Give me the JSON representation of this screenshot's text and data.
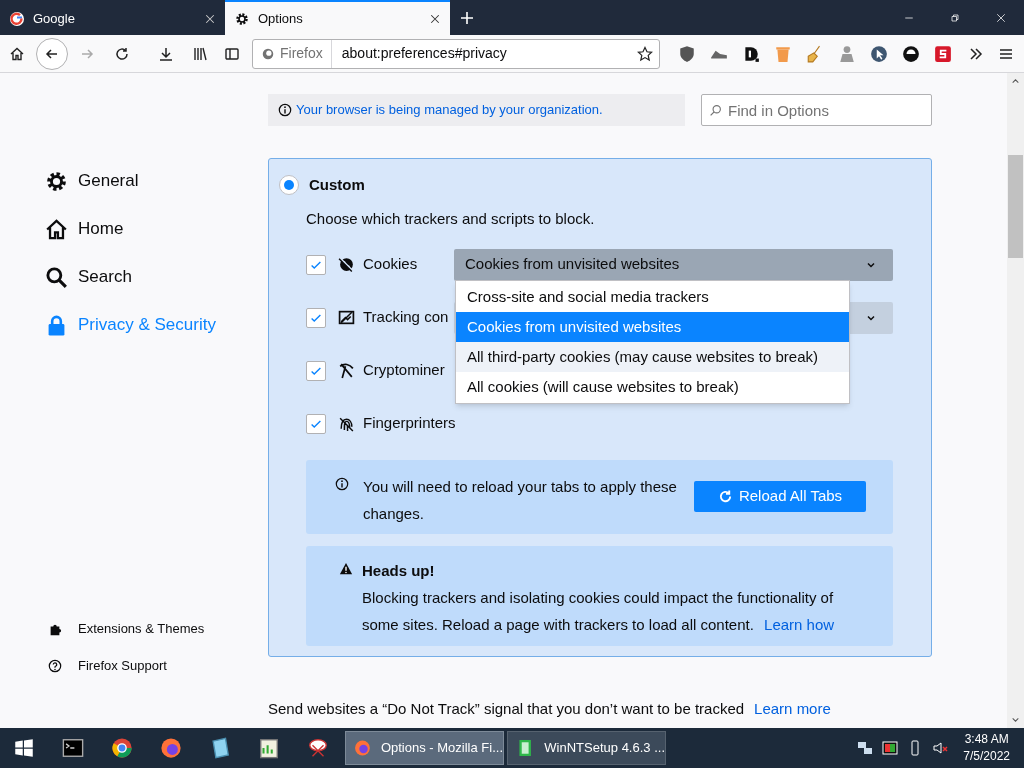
{
  "tabs": [
    {
      "title": "Google",
      "selected": false
    },
    {
      "title": "Options",
      "selected": true
    }
  ],
  "toolbar": {
    "identity": "Firefox",
    "url": "about:preferences#privacy"
  },
  "sidebar": {
    "items": [
      {
        "label": "General",
        "selected": false
      },
      {
        "label": "Home",
        "selected": false
      },
      {
        "label": "Search",
        "selected": false
      },
      {
        "label": "Privacy & Security",
        "selected": true
      }
    ],
    "footer": [
      "Extensions & Themes",
      "Firefox Support"
    ]
  },
  "managed_notice": "Your browser is being managed by your organization.",
  "search": {
    "placeholder": "Find in Options"
  },
  "custom": {
    "title": "Custom",
    "selected": true,
    "description": "Choose which trackers and scripts to block.",
    "trackers": [
      {
        "label": "Cookies",
        "checked": true,
        "dropdown": "Cookies from unvisited websites",
        "expanded": true
      },
      {
        "label": "Tracking con",
        "checked": true,
        "expanded": false
      },
      {
        "label": "Cryptominer",
        "checked": true
      },
      {
        "label": "Fingerprinters",
        "checked": true
      }
    ],
    "options": [
      {
        "label": "Cross-site and social media trackers",
        "selected": false,
        "hovered": false
      },
      {
        "label": "Cookies from unvisited websites",
        "selected": true,
        "hovered": false
      },
      {
        "label": "All third-party cookies (may cause websites to break)",
        "selected": false,
        "hovered": true
      },
      {
        "label": "All cookies (will cause websites to break)",
        "selected": false,
        "hovered": false
      }
    ],
    "reload_notice": "You will need to reload your tabs to apply these changes.",
    "reload_button": "Reload All Tabs",
    "warning": {
      "title": "Heads up!",
      "text": "Blocking trackers and isolating cookies could impact the functionality of some sites. Reload a page with trackers to load all content.",
      "link": "Learn how"
    }
  },
  "do_not_track": {
    "text": "Send websites a “Do Not Track” signal that you don’t want to be tracked",
    "link": "Learn more"
  },
  "taskbar": {
    "windows": [
      {
        "title": "Options - Mozilla Fi...",
        "selected": true
      },
      {
        "title": "WinNTSetup 4.6.3  ...",
        "selected": false
      }
    ],
    "time": "3:48 AM",
    "date": "7/5/2022"
  }
}
